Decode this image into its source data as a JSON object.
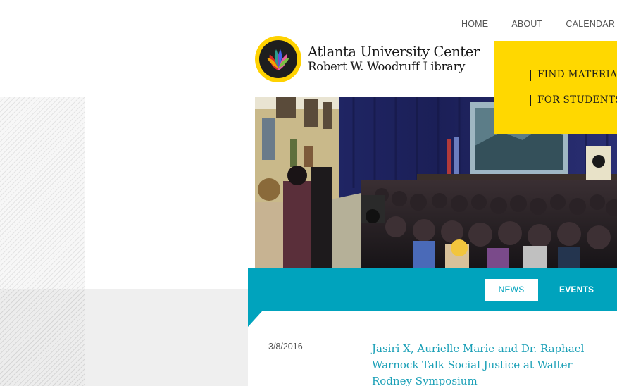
{
  "top_nav": {
    "items": [
      {
        "label": "HOME"
      },
      {
        "label": "ABOUT"
      },
      {
        "label": "CALENDAR"
      }
    ]
  },
  "logo": {
    "line1": "Atlanta University Center",
    "line2": "Robert W. Woodruff Library",
    "icon": "flame-emblem-icon"
  },
  "menu": {
    "items": [
      {
        "label": "FIND MATERIALS"
      },
      {
        "label": "FOR STUDENTS"
      }
    ]
  },
  "tabs": {
    "items": [
      {
        "label": "NEWS",
        "active": true
      },
      {
        "label": "EVENTS",
        "active": false
      }
    ]
  },
  "news": {
    "items": [
      {
        "date": "3/8/2016",
        "title": "Jasiri X, Aurielle Marie and Dr. Raphael Warnock Talk Social Justice at Walter Rodney Symposium"
      }
    ]
  },
  "colors": {
    "accent_yellow": "#ffd800",
    "accent_teal": "#00a3bd",
    "link_teal": "#1ba0b7"
  }
}
